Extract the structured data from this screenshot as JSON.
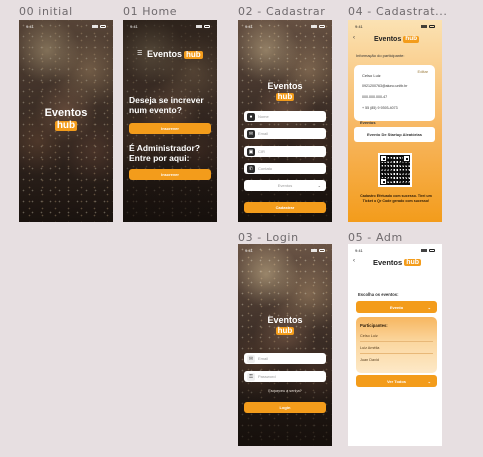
{
  "frames": {
    "initial": {
      "label": "00  initial",
      "logo_top": "Eventos",
      "logo_hub": "hub",
      "time": "9:41"
    },
    "home": {
      "label": "01  Home",
      "time": "9:41",
      "logo_top": "Eventos",
      "logo_hub": "hub",
      "question1": "Deseja se increver num evento?",
      "button1": "Inscrever",
      "question2": "É Administrador? Entre por aqui:",
      "button2": "Inscrever"
    },
    "cadastrar": {
      "label": "02  - Cadastrar",
      "time": "9:41",
      "logo_top": "Eventos",
      "logo_hub": "hub",
      "fields": [
        {
          "placeholder": "Nome",
          "icon": "user-icon"
        },
        {
          "placeholder": "Email",
          "icon": "mail-icon"
        },
        {
          "placeholder": "CIR",
          "icon": "id-icon"
        },
        {
          "placeholder": "Contato",
          "icon": "phone-icon"
        }
      ],
      "select_value": "Eventos",
      "submit": "Cadastrar"
    },
    "cadastrar_ticket": {
      "label": "04 - Cadastrat...",
      "time": "9:41",
      "logo_top": "Eventos",
      "logo_hub": "hub",
      "section": "Informação do participante:",
      "edit": "Editar",
      "name": "Celso Luiz",
      "email": "0921200763@aluno.unitb.br",
      "cir": "000.000.000-47",
      "phone": "+ 55 (85) 9 9393-4073",
      "event_heading": "Eventos",
      "event_name": "Evento De Startup Aleatórias",
      "footer": "Cadastro Efetuado com sucesso. Tirei um Ticket o Qr Code gerado com sucesso!"
    },
    "login": {
      "label": "03  - Login",
      "time": "9:41",
      "logo_top": "Eventos",
      "logo_hub": "hub",
      "email_placeholder": "Email",
      "password_placeholder": "Password",
      "forgot": "Esqueceu a senha?",
      "submit": "Login"
    },
    "adm": {
      "label": "05  - Adm",
      "time": "9:41",
      "logo_top": "Eventos",
      "logo_hub": "hub",
      "choose": "Escolha os eventos:",
      "select_value": "Evento",
      "participants": "Participantes:",
      "names": [
        "Celso Luiz",
        "Luiz Amélia",
        "Juan David"
      ],
      "button": "Ver Todos"
    }
  },
  "colors": {
    "accent": "#f39c1b",
    "canvas": "#e7dfe1"
  }
}
